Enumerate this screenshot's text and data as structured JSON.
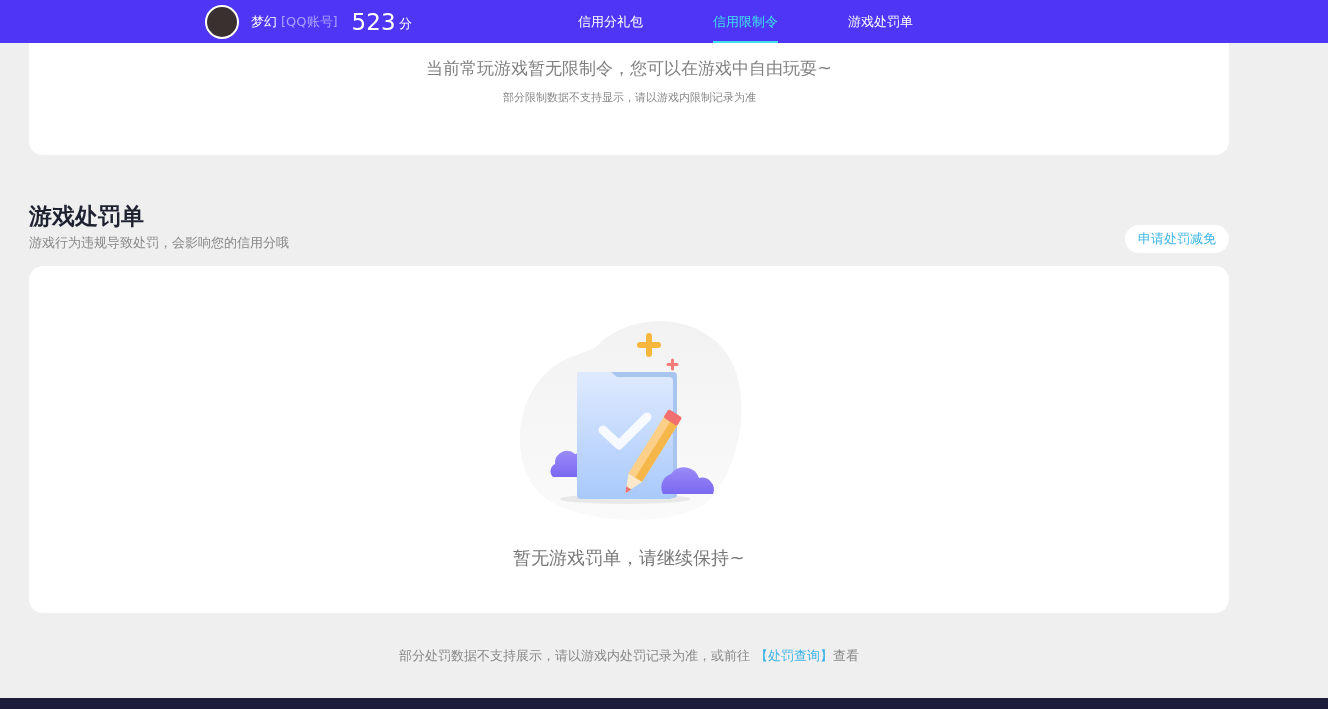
{
  "header": {
    "user_name": "梦幻",
    "account_type": "[QQ账号]",
    "score": "523",
    "score_unit": "分",
    "tabs": [
      {
        "label": "信用分礼包",
        "selected": false
      },
      {
        "label": "信用限制令",
        "selected": true
      },
      {
        "label": "游戏处罚单",
        "selected": false
      }
    ]
  },
  "restriction_card": {
    "message": "当前常玩游戏暂无限制令，您可以在游戏中自由玩耍~",
    "note": "部分限制数据不支持显示，请以游戏内限制记录为准"
  },
  "penalty_section": {
    "title": "游戏处罚单",
    "subtitle": "游戏行为违规导致处罚，会影响您的信用分哦",
    "button": "申请处罚减免",
    "empty_message": "暂无游戏罚单，请继续保持~"
  },
  "footer_note": {
    "text_before": "部分处罚数据不支持展示，请以游戏内处罚记录为准，或前往 ",
    "link": "【处罚查询】",
    "text_after": "查看"
  }
}
